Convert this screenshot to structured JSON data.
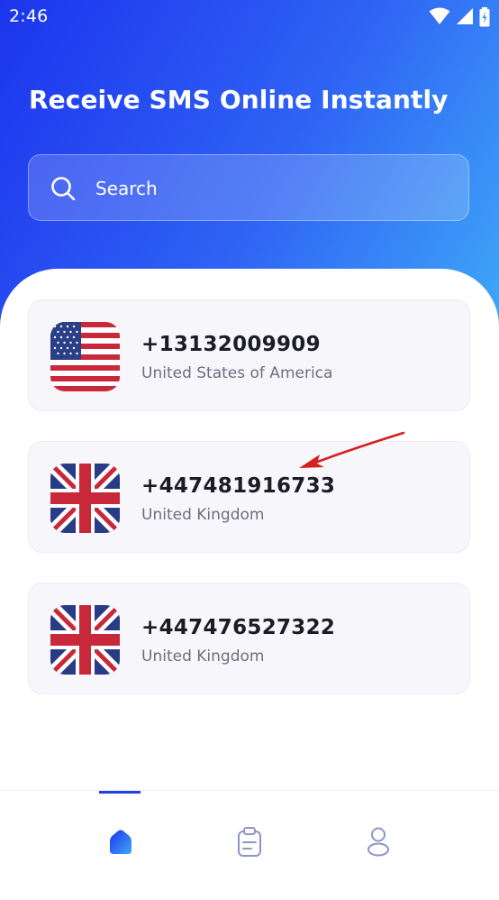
{
  "status_bar": {
    "time": "2:46",
    "icons": [
      "wifi-icon",
      "cellular-signal-icon",
      "battery-charging-icon"
    ]
  },
  "header": {
    "title": "Receive SMS Online Instantly"
  },
  "search": {
    "placeholder": "Search",
    "icon": "search-icon"
  },
  "numbers": [
    {
      "phone": "+13132009909",
      "country": "United States of America",
      "flag": "us-flag"
    },
    {
      "phone": "+447481916733",
      "country": "United Kingdom",
      "flag": "uk-flag"
    },
    {
      "phone": "+447476527322",
      "country": "United Kingdom",
      "flag": "uk-flag"
    }
  ],
  "bottom_nav": {
    "items": [
      "home-icon",
      "clipboard-icon",
      "profile-icon"
    ],
    "active": "home-icon"
  },
  "colors": {
    "gradient_start": "#1c34ee",
    "gradient_end": "#3fa7f8",
    "accent": "#1f3fe8",
    "annotation_arrow": "#d61f1f"
  }
}
